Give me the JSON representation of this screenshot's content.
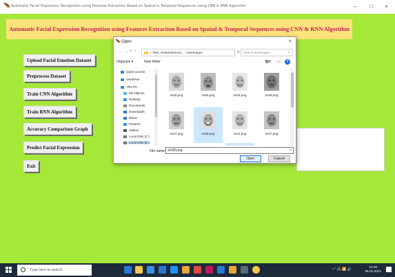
{
  "window": {
    "title": "Automatic Facial Expression Recognition using Features Extraction Based on Spatial & Temporal Sequences using CNN & RNN Algorithm",
    "minimize": "–",
    "maximize": "□",
    "close": "×"
  },
  "banner": {
    "text": "Automatic Facial Expression Recognition using Features Extraction Based on Spatial & Temporal Sequences using CNN & RNN Algorithm"
  },
  "sidebar": {
    "buttons": [
      {
        "label": "Upload Facial Emotion Dataset"
      },
      {
        "label": "Preprocess Dataset"
      },
      {
        "label": "Train CNN Algorithm"
      },
      {
        "label": "Train RNN Algorithm"
      },
      {
        "label": "Accuracy Comparison Graph"
      },
      {
        "label": "Predict Facial Expression"
      },
      {
        "label": "Exit"
      }
    ]
  },
  "dialog": {
    "title": "Open",
    "close": "×",
    "address": "« TitleI_FeatureExtract... › testImages",
    "search_placeholder": "Search testImages",
    "organize": "Organize ▾",
    "new_folder": "New folder",
    "nav": [
      {
        "label": "Quick access",
        "icon": "star-icon",
        "color": "#2d7be5"
      },
      {
        "label": "OneDrive",
        "icon": "cloud-icon",
        "color": "#2b78d4"
      },
      {
        "label": "This PC",
        "icon": "pc-icon",
        "color": "#3a8ee6"
      },
      {
        "label": "3D Objects",
        "icon": "cube-icon",
        "color": "#5ab0f0"
      },
      {
        "label": "Desktop",
        "icon": "desktop-icon",
        "color": "#3a8ee6"
      },
      {
        "label": "Documents",
        "icon": "document-icon",
        "color": "#8a8a8a"
      },
      {
        "label": "Downloads",
        "icon": "download-icon",
        "color": "#2b78d4"
      },
      {
        "label": "Music",
        "icon": "music-icon",
        "color": "#2b78d4"
      },
      {
        "label": "Pictures",
        "icon": "pictures-icon",
        "color": "#3a8ee6"
      },
      {
        "label": "Videos",
        "icon": "video-icon",
        "color": "#555555"
      },
      {
        "label": "Local Disk (C:)",
        "icon": "disk-icon",
        "color": "#777777"
      },
      {
        "label": "Local Disk (E:)",
        "icon": "disk-icon",
        "color": "#777777"
      }
    ],
    "files": [
      {
        "name": "im25.png"
      },
      {
        "name": "im26.png"
      },
      {
        "name": "im34.png"
      },
      {
        "name": "im36.png"
      },
      {
        "name": "im37.png"
      },
      {
        "name": "im38.png"
      },
      {
        "name": "im41.png"
      },
      {
        "name": "im47.png"
      },
      {
        "name": ""
      },
      {
        "name": ""
      },
      {
        "name": ""
      },
      {
        "name": ""
      }
    ],
    "file_name_label": "File name:",
    "file_name_value": "im38.png",
    "open_label": "Open",
    "cancel_label": "Cancel"
  },
  "taskbar": {
    "search_placeholder": "Type here to search",
    "clock_time": "21:05",
    "clock_date": "05-02-2021",
    "tray_text": "ᵖ ^ 🖧 📶 🔊"
  }
}
